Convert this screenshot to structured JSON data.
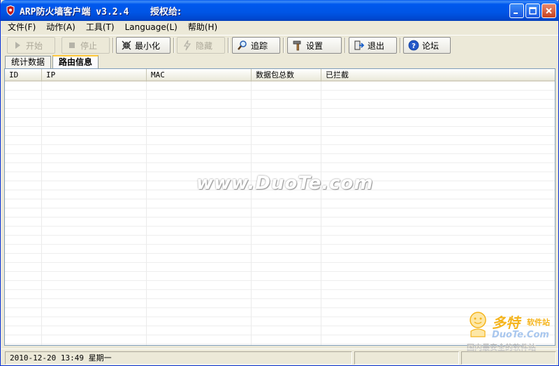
{
  "window": {
    "title": "ARP防火墙客户端 v3.2.4",
    "auth_label": "授权给:"
  },
  "menu": [
    {
      "label": "文件(F)"
    },
    {
      "label": "动作(A)"
    },
    {
      "label": "工具(T)"
    },
    {
      "label": "Language(L)"
    },
    {
      "label": "帮助(H)"
    }
  ],
  "toolbar": {
    "start": "开始",
    "stop": "停止",
    "minimize": "最小化",
    "hide": "隐藏",
    "trace": "追踪",
    "settings": "设置",
    "exit": "退出",
    "forum": "论坛"
  },
  "tabs": [
    {
      "label": "统计数据",
      "active": false
    },
    {
      "label": "路由信息",
      "active": true
    }
  ],
  "table": {
    "columns": [
      "ID",
      "IP",
      "MAC",
      "数据包总数",
      "已拦截"
    ],
    "rows": []
  },
  "watermark": "www.DuoTe.com",
  "status": {
    "datetime": "2010-12-20 13:49 星期一"
  },
  "corner_logo": {
    "brand": "多特",
    "sub": "软件站",
    "url": "DuoTe.Com",
    "slogan": "国内最安全的软件站"
  },
  "colors": {
    "titlebar": "#0055E5",
    "window_bg": "#ECE9D8",
    "tab_highlight": "#FFC83C"
  }
}
